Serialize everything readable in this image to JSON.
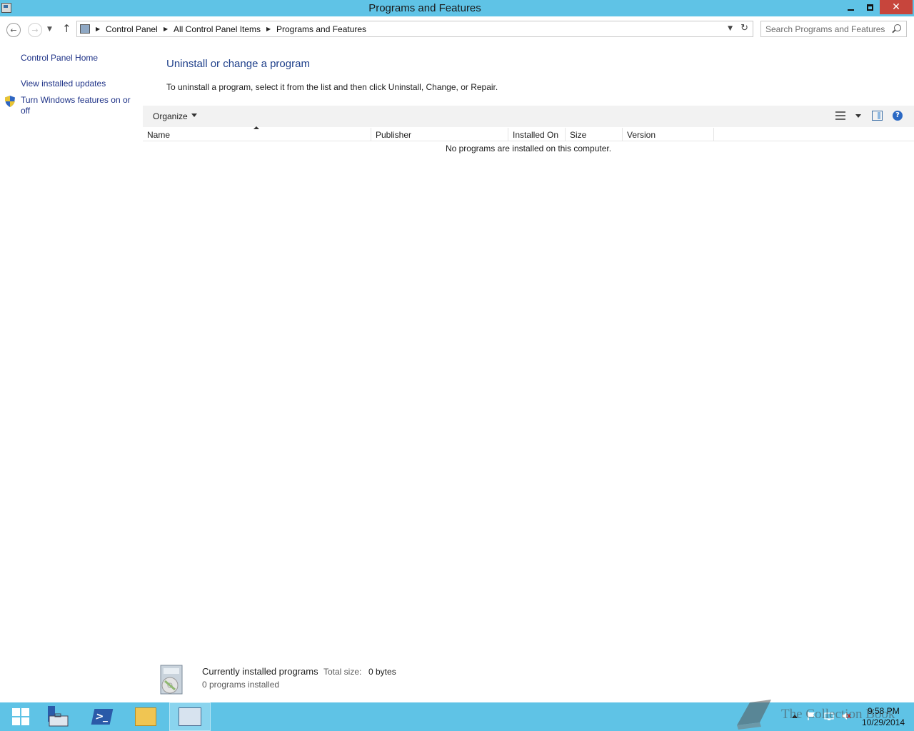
{
  "window": {
    "title": "Programs and Features"
  },
  "address_bar": {
    "breadcrumbs": [
      "Control Panel",
      "All Control Panel Items",
      "Programs and Features"
    ]
  },
  "search": {
    "placeholder": "Search Programs and Features"
  },
  "left_pane": {
    "home_link": "Control Panel Home",
    "updates_link": "View installed updates",
    "features_link": "Turn Windows features on or off"
  },
  "main": {
    "heading": "Uninstall or change a program",
    "instructions": "To uninstall a program, select it from the list and then click Uninstall, Change, or Repair.",
    "toolbar": {
      "organize_label": "Organize"
    },
    "columns": [
      "Name",
      "Publisher",
      "Installed On",
      "Size",
      "Version"
    ],
    "empty_message": "No programs are installed on this computer."
  },
  "details": {
    "title": "Currently installed programs",
    "size_label": "Total size:",
    "size_value": "0 bytes",
    "count": "0 programs installed"
  },
  "taskbar": {
    "clock_time": "9:58 PM",
    "clock_date": "10/29/2014",
    "watermark": "The Collection Book"
  },
  "colors": {
    "titlebar": "#5fc3e6",
    "close_button": "#c7453c",
    "link": "#1e3287",
    "heading": "#1e3f8a",
    "taskbar": "#5fc3e6"
  }
}
